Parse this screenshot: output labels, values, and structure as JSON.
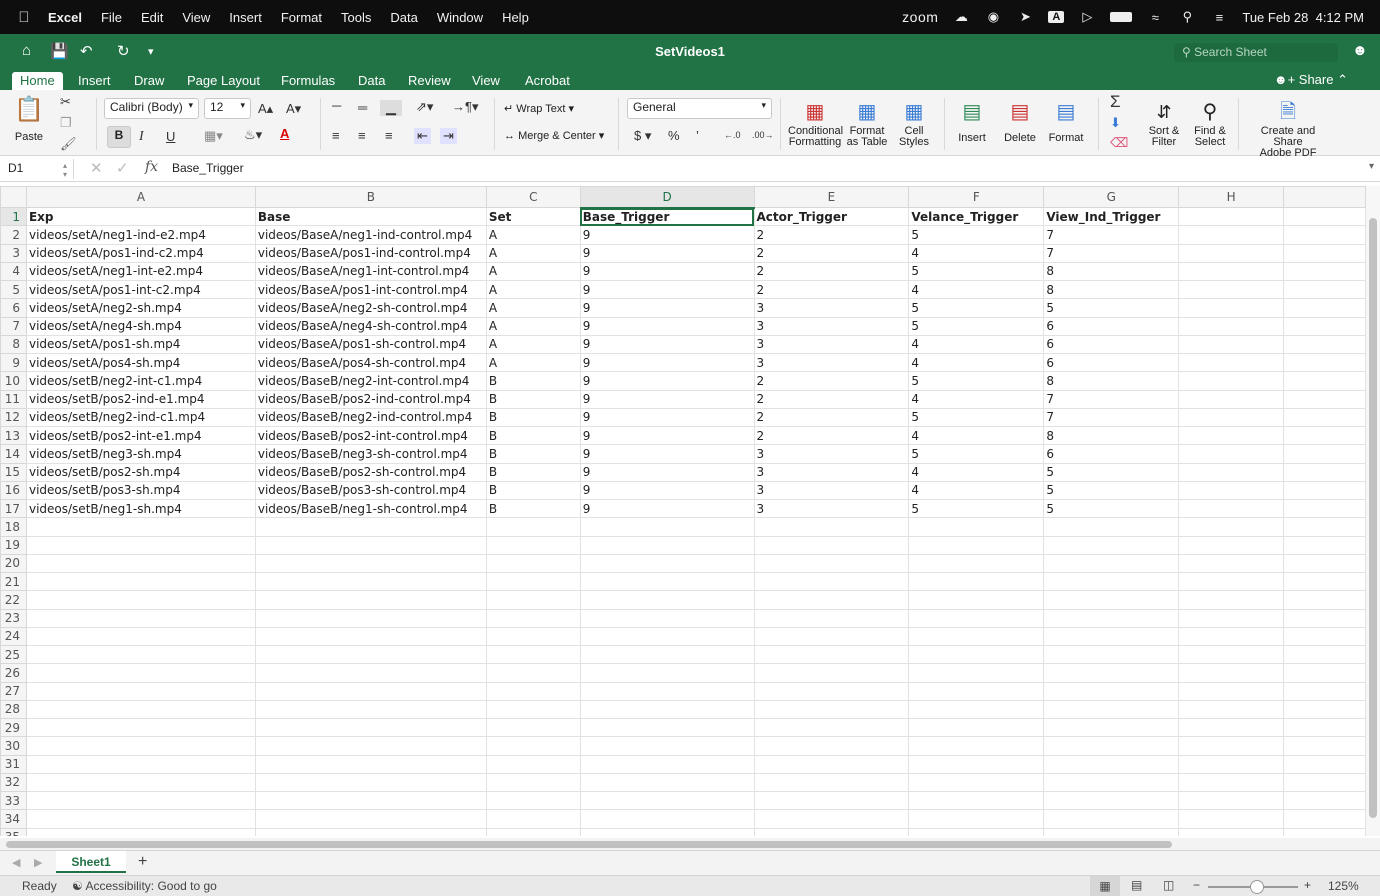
{
  "menubar": {
    "app": "Excel",
    "items": [
      "File",
      "Edit",
      "View",
      "Insert",
      "Format",
      "Tools",
      "Data",
      "Window",
      "Help"
    ],
    "zoom_label": "zoom",
    "datetime": "Tue Feb 28  4:12 PM",
    "input_indicator": "A"
  },
  "titlebar": {
    "doc_title": "SetVideos1",
    "search_placeholder": "Search Sheet"
  },
  "ribbon_tabs": [
    "Home",
    "Insert",
    "Draw",
    "Page Layout",
    "Formulas",
    "Data",
    "Review",
    "View",
    "Acrobat"
  ],
  "share_label": "Share",
  "ribbon": {
    "paste": "Paste",
    "font_name": "Calibri (Body)",
    "font_size": "12",
    "bold": "B",
    "italic": "I",
    "underline": "U",
    "wrap_text": "Wrap Text",
    "merge_center": "Merge & Center",
    "number_format": "General",
    "currency": "$",
    "percent": "%",
    "comma": "’",
    "cond_fmt_1": "Conditional",
    "cond_fmt_2": "Formatting",
    "fmt_table_1": "Format",
    "fmt_table_2": "as Table",
    "cell_styles_1": "Cell",
    "cell_styles_2": "Styles",
    "insert": "Insert",
    "delete": "Delete",
    "format": "Format",
    "sort_1": "Sort &",
    "sort_2": "Filter",
    "find_1": "Find &",
    "find_2": "Select",
    "adobe_1": "Create and Share",
    "adobe_2": "Adobe PDF"
  },
  "formula_bar": {
    "name_box": "D1",
    "fx": "fx",
    "content": "Base_Trigger"
  },
  "sheet": {
    "columns": [
      "A",
      "B",
      "C",
      "D",
      "E",
      "F",
      "G",
      "H"
    ],
    "rows": [
      [
        "Exp",
        "Base",
        "Set",
        "Base_Trigger",
        "Actor_Trigger",
        "Velance_Trigger",
        "View_Ind_Trigger",
        ""
      ],
      [
        "videos/setA/neg1-ind-e2.mp4",
        "videos/BaseA/neg1-ind-control.mp4",
        "A",
        "9",
        "2",
        "5",
        "7",
        ""
      ],
      [
        "videos/setA/pos1-ind-c2.mp4",
        "videos/BaseA/pos1-ind-control.mp4",
        "A",
        "9",
        "2",
        "4",
        "7",
        ""
      ],
      [
        "videos/setA/neg1-int-e2.mp4",
        "videos/BaseA/neg1-int-control.mp4",
        "A",
        "9",
        "2",
        "5",
        "8",
        ""
      ],
      [
        "videos/setA/pos1-int-c2.mp4",
        "videos/BaseA/pos1-int-control.mp4",
        "A",
        "9",
        "2",
        "4",
        "8",
        ""
      ],
      [
        "videos/setA/neg2-sh.mp4",
        "videos/BaseA/neg2-sh-control.mp4",
        "A",
        "9",
        "3",
        "5",
        "5",
        ""
      ],
      [
        "videos/setA/neg4-sh.mp4",
        "videos/BaseA/neg4-sh-control.mp4",
        "A",
        "9",
        "3",
        "5",
        "6",
        ""
      ],
      [
        "videos/setA/pos1-sh.mp4",
        "videos/BaseA/pos1-sh-control.mp4",
        "A",
        "9",
        "3",
        "4",
        "6",
        ""
      ],
      [
        "videos/setA/pos4-sh.mp4",
        "videos/BaseA/pos4-sh-control.mp4",
        "A",
        "9",
        "3",
        "4",
        "6",
        ""
      ],
      [
        "videos/setB/neg2-int-c1.mp4",
        "videos/BaseB/neg2-int-control.mp4",
        "B",
        "9",
        "2",
        "5",
        "8",
        ""
      ],
      [
        "videos/setB/pos2-ind-e1.mp4",
        "videos/BaseB/pos2-ind-control.mp4",
        "B",
        "9",
        "2",
        "4",
        "7",
        ""
      ],
      [
        "videos/setB/neg2-ind-c1.mp4",
        "videos/BaseB/neg2-ind-control.mp4",
        "B",
        "9",
        "2",
        "5",
        "7",
        ""
      ],
      [
        "videos/setB/pos2-int-e1.mp4",
        "videos/BaseB/pos2-int-control.mp4",
        "B",
        "9",
        "2",
        "4",
        "8",
        ""
      ],
      [
        "videos/setB/neg3-sh.mp4",
        "videos/BaseB/neg3-sh-control.mp4",
        "B",
        "9",
        "3",
        "5",
        "6",
        ""
      ],
      [
        "videos/setB/pos2-sh.mp4",
        "videos/BaseB/pos2-sh-control.mp4",
        "B",
        "9",
        "3",
        "4",
        "5",
        ""
      ],
      [
        "videos/setB/pos3-sh.mp4",
        "videos/BaseB/pos3-sh-control.mp4",
        "B",
        "9",
        "3",
        "4",
        "5",
        ""
      ],
      [
        "videos/setB/neg1-sh.mp4",
        "videos/BaseB/neg1-sh-control.mp4",
        "B",
        "9",
        "3",
        "5",
        "5",
        ""
      ]
    ],
    "empty_row_count": 18,
    "selected_cell": "D1"
  },
  "sheet_tabs": [
    "Sheet1"
  ],
  "status": {
    "ready": "Ready",
    "accessibility": "Accessibility: Good to go",
    "zoom": "125%"
  },
  "colors": {
    "accent": "#217346",
    "menubar": "#0e0e0e"
  }
}
